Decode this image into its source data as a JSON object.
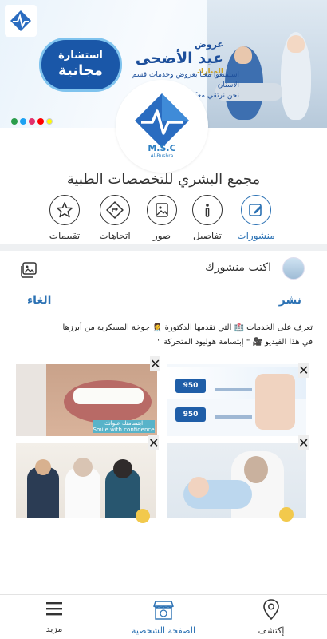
{
  "cover": {
    "offer_line1": "استشارة",
    "offer_line2": "مجانية",
    "headline_small": "عروض",
    "headline_big": "عيد الأضحى",
    "headline_sub": "المبارك",
    "tagline_1": "استمتعوا معنا بعروض وخدمات قسم الاسنان",
    "tagline_2": "نحن نرتقي معكم"
  },
  "profile": {
    "logo_text": "M.S.C",
    "logo_sub": "Al-Bushra",
    "name": "مجمع البشري للتخصصات الطبية"
  },
  "actions": [
    {
      "id": "posts",
      "label": "منشورات",
      "icon": "edit-icon",
      "active": true
    },
    {
      "id": "details",
      "label": "تفاصيل",
      "icon": "info-icon",
      "active": false
    },
    {
      "id": "photos",
      "label": "صور",
      "icon": "image-icon",
      "active": false
    },
    {
      "id": "directions",
      "label": "اتجاهات",
      "icon": "directions-icon",
      "active": false
    },
    {
      "id": "reviews",
      "label": "تقييمات",
      "icon": "star-icon",
      "active": false
    }
  ],
  "compose": {
    "prompt": "اكتب منشورك",
    "publish_label": "نشر",
    "cancel_label": "الغاء"
  },
  "post": {
    "line1": "تعرف على الخدمات 🏥 التي تقدمها الدكتورة 👩‍⚕️ جوخة المسكرية من أبرزها",
    "line2": "في هذا الفيديو 🎥 \" إبتسامة هوليود المتحركة \""
  },
  "images": [
    {
      "name": "hollywood-smile-image",
      "caption": "ابتسامتك عنوانك",
      "caption_en": "Smile with confidence"
    },
    {
      "name": "dental-offers-flyer-image",
      "price_1": "950",
      "price_2": "950"
    },
    {
      "name": "medical-team-photo-image"
    },
    {
      "name": "doctor-with-baby-image"
    }
  ],
  "bottom_nav": [
    {
      "id": "more",
      "label": "مزيد",
      "icon": "menu-icon",
      "active": false
    },
    {
      "id": "profile",
      "label": "الصفحة الشخصية",
      "icon": "storefront-icon",
      "active": true
    },
    {
      "id": "explore",
      "label": "إكتشف",
      "icon": "location-pin-icon",
      "active": false
    }
  ],
  "colors": {
    "accent": "#2c72b4",
    "brand_dark": "#1d4f9b",
    "divider": "#eef0f2"
  }
}
